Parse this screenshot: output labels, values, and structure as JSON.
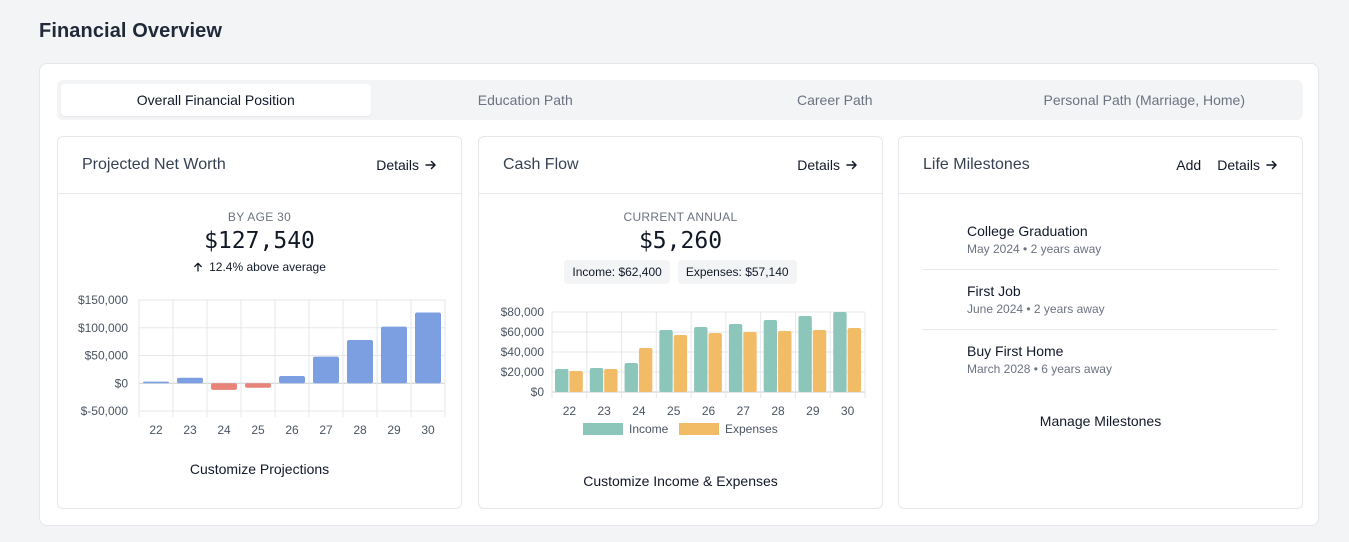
{
  "page": {
    "title": "Financial Overview"
  },
  "tabs": [
    {
      "label": "Overall Financial Position",
      "active": true
    },
    {
      "label": "Education Path",
      "active": false
    },
    {
      "label": "Career Path",
      "active": false
    },
    {
      "label": "Personal Path (Marriage, Home)",
      "active": false
    }
  ],
  "net_worth": {
    "title": "Projected Net Worth",
    "details_label": "Details",
    "metric_label": "BY AGE 30",
    "metric_value": "$127,540",
    "trend_text": "12.4% above average",
    "footer_label": "Customize Projections"
  },
  "cash_flow": {
    "title": "Cash Flow",
    "details_label": "Details",
    "metric_label": "CURRENT ANNUAL",
    "metric_value": "$5,260",
    "income_pill": "Income: $62,400",
    "expenses_pill": "Expenses: $57,140",
    "footer_label": "Customize Income & Expenses"
  },
  "milestones": {
    "title": "Life Milestones",
    "add_label": "Add",
    "details_label": "Details",
    "items": [
      {
        "title": "College Graduation",
        "subtitle": "May 2024 • 2 years away"
      },
      {
        "title": "First Job",
        "subtitle": "June 2024 • 2 years away"
      },
      {
        "title": "Buy First Home",
        "subtitle": "March 2028 • 6 years away"
      }
    ],
    "footer_label": "Manage Milestones"
  },
  "colors": {
    "positive_bar": "#7b9fe0",
    "negative_bar": "#e8837a",
    "income_bar": "#8cc5ba",
    "expenses_bar": "#f2bc66"
  },
  "chart_data": [
    {
      "type": "bar",
      "categories": [
        "22",
        "23",
        "24",
        "25",
        "26",
        "27",
        "28",
        "29",
        "30"
      ],
      "values": [
        3000,
        10000,
        -12000,
        -8000,
        13000,
        48000,
        78000,
        102000,
        127540
      ],
      "ylim": [
        -50000,
        150000
      ],
      "yticks": [
        150000,
        100000,
        50000,
        0,
        -50000
      ],
      "ytick_labels": [
        "$150,000",
        "$100,000",
        "$50,000",
        "$0",
        "$-50,000"
      ],
      "grid": true
    },
    {
      "type": "bar",
      "categories": [
        "22",
        "23",
        "24",
        "25",
        "26",
        "27",
        "28",
        "29",
        "30"
      ],
      "series": [
        {
          "name": "Income",
          "values": [
            23000,
            24000,
            29000,
            62000,
            65000,
            68000,
            72000,
            76000,
            80000
          ]
        },
        {
          "name": "Expenses",
          "values": [
            21000,
            23000,
            44000,
            57000,
            59000,
            60000,
            61000,
            62000,
            64000
          ]
        }
      ],
      "ylim": [
        0,
        80000
      ],
      "yticks": [
        80000,
        60000,
        40000,
        20000,
        0
      ],
      "ytick_labels": [
        "$80,000",
        "$60,000",
        "$40,000",
        "$20,000",
        "$0"
      ],
      "legend": "bottom",
      "grid": true
    }
  ]
}
